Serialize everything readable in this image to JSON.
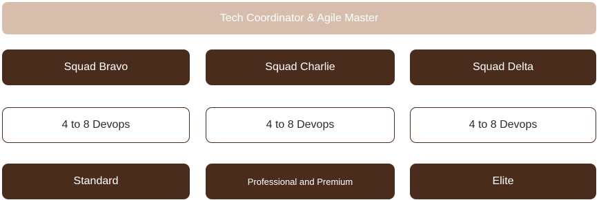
{
  "header": {
    "title": "Tech Coordinator & Agile Master"
  },
  "squads": [
    {
      "name": "Squad Bravo",
      "team": "4 to 8 Devops",
      "tier": "Standard"
    },
    {
      "name": "Squad Charlie",
      "team": "4 to 8 Devops",
      "tier": "Professional and Premium"
    },
    {
      "name": "Squad Delta",
      "team": "4 to 8 Devops",
      "tier": "Elite"
    }
  ],
  "colors": {
    "header_bg": "#d7bdac",
    "dark_bg": "#4a2c1c",
    "light_border": "#4a2c1c"
  }
}
